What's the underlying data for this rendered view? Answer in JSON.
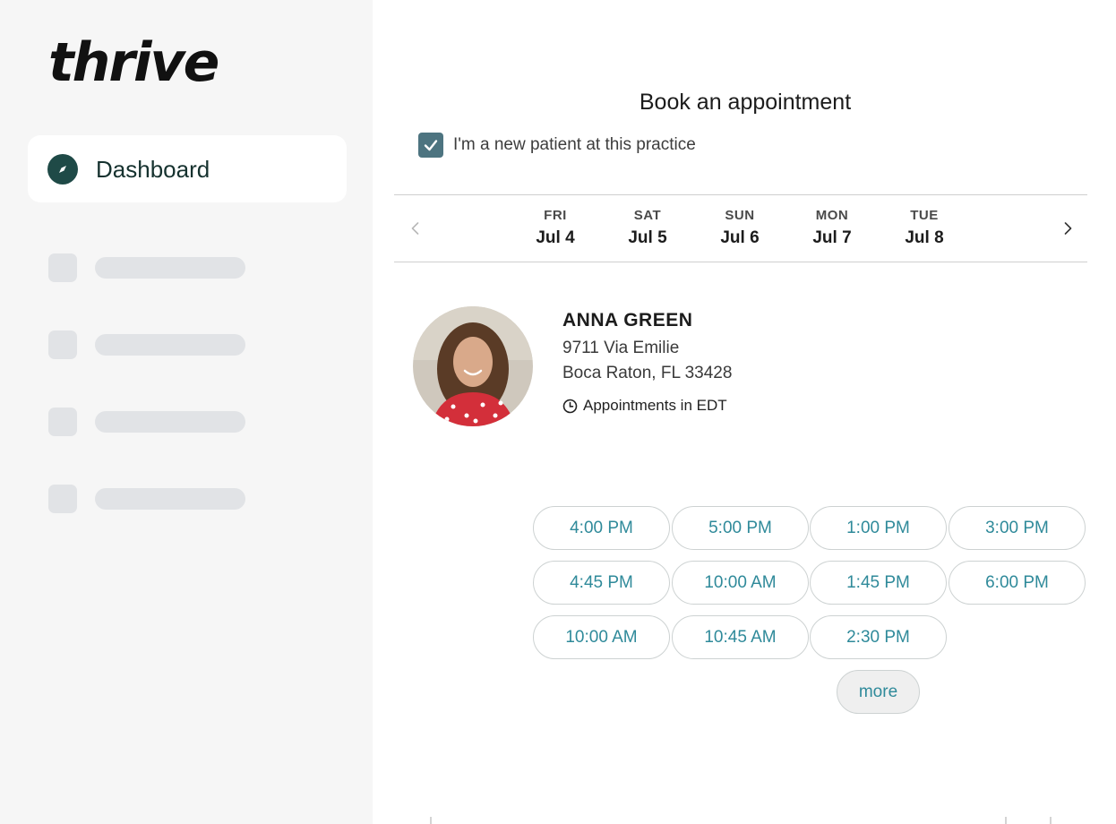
{
  "brand": {
    "logo_text": "thrive",
    "accent": "#1f4a47"
  },
  "sidebar": {
    "active_item": {
      "label": "Dashboard",
      "icon": "compass-icon"
    },
    "placeholder_count": 4
  },
  "booking": {
    "title": "Book an appointment",
    "new_patient": {
      "label": "I'm a new patient at this practice",
      "checked": true
    },
    "dates": [
      {
        "dow": "FRI",
        "date": "Jul 4"
      },
      {
        "dow": "SAT",
        "date": "Jul 5"
      },
      {
        "dow": "SUN",
        "date": "Jul 6"
      },
      {
        "dow": "MON",
        "date": "Jul 7"
      },
      {
        "dow": "TUE",
        "date": "Jul 8"
      }
    ],
    "provider": {
      "name": "ANNA GREEN",
      "address_line1": "9711 Via Emilie",
      "address_line2": "Boca Raton, FL 33428",
      "timezone_label": "Appointments in EDT"
    },
    "slots": {
      "row1": [
        "4:00 PM",
        "5:00 PM",
        "1:00 PM",
        "3:00 PM"
      ],
      "row2": [
        "4:45 PM",
        "10:00 AM",
        "1:45 PM",
        "6:00 PM"
      ],
      "row3": [
        "10:00 AM",
        "10:45 AM",
        "2:30 PM"
      ]
    },
    "more_label": "more",
    "slot_color": "#2f8a9a"
  }
}
